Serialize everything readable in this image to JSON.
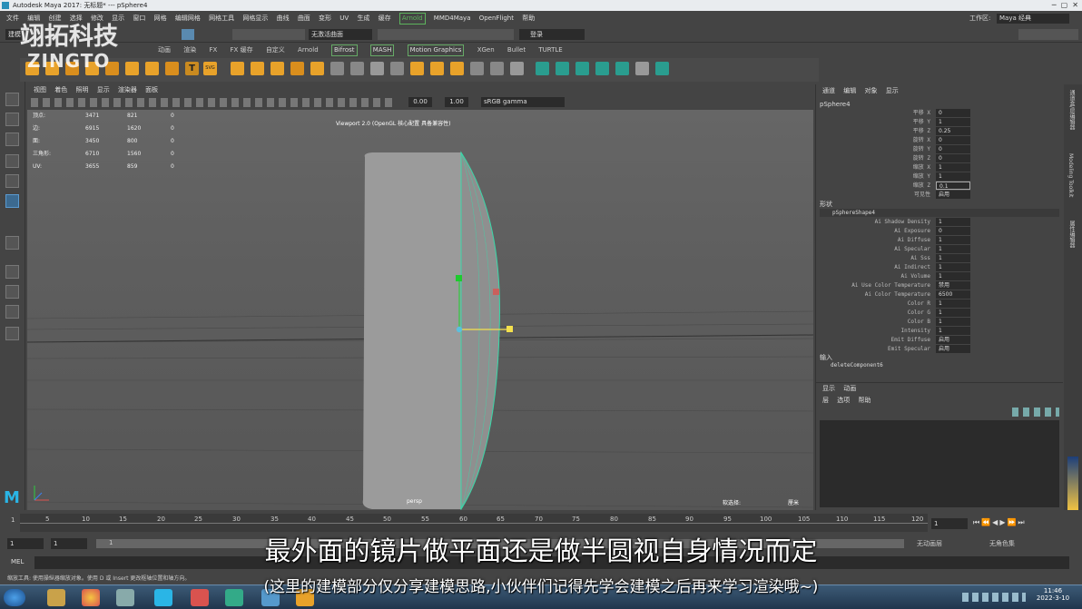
{
  "window": {
    "title": "Autodesk Maya 2017: 无标题*   ---   pSphere4"
  },
  "menu": {
    "items": [
      "文件",
      "编辑",
      "创建",
      "选择",
      "修改",
      "显示",
      "窗口",
      "网格",
      "编辑网格",
      "网格工具",
      "网格显示",
      "曲线",
      "曲面",
      "变形",
      "UV",
      "生成",
      "缓存",
      "Arnold",
      "MMD4Maya",
      "OpenFlight",
      "帮助"
    ],
    "workspace_label": "工作区:",
    "workspace_value": "Maya 经典"
  },
  "statusline": {
    "mode": "建模",
    "no_live": "无激活曲面",
    "login": "登录"
  },
  "shelf_tabs": [
    "动画",
    "渲染",
    "FX",
    "FX 缓存",
    "自定义",
    "Arnold",
    "Bifrost",
    "MASH",
    "Motion Graphics",
    "XGen",
    "Bullet",
    "TURTLE"
  ],
  "viewport": {
    "menu": [
      "视图",
      "着色",
      "照明",
      "显示",
      "渲染器",
      "面板"
    ],
    "exposure": "0.00",
    "gamma": "1.00",
    "colorspace": "sRGB gamma",
    "title": "Viewport 2.0 (OpenGL 核心配置 具备兼容性)",
    "camera": "persp",
    "sel_key": "软选择:",
    "units": "厘米",
    "hud": [
      {
        "label": "顶点:",
        "a": "3471",
        "b": "821",
        "c": "0"
      },
      {
        "label": "边:",
        "a": "6915",
        "b": "1620",
        "c": "0"
      },
      {
        "label": "面:",
        "a": "3450",
        "b": "800",
        "c": "0"
      },
      {
        "label": "三角形:",
        "a": "6710",
        "b": "1560",
        "c": "0"
      },
      {
        "label": "UV:",
        "a": "3655",
        "b": "859",
        "c": "0"
      }
    ]
  },
  "channelbox": {
    "tabs": [
      "通道",
      "编辑",
      "对象",
      "显示"
    ],
    "object": "pSphere4",
    "attrs": [
      {
        "l": "平移 X",
        "v": "0"
      },
      {
        "l": "平移 Y",
        "v": "1"
      },
      {
        "l": "平移 Z",
        "v": "0.25"
      },
      {
        "l": "旋转 X",
        "v": "0"
      },
      {
        "l": "旋转 Y",
        "v": "0"
      },
      {
        "l": "旋转 Z",
        "v": "0"
      },
      {
        "l": "缩放 X",
        "v": "1"
      },
      {
        "l": "缩放 Y",
        "v": "1"
      },
      {
        "l": "缩放 Z",
        "v": "0.1"
      },
      {
        "l": "可见性",
        "v": "启用"
      }
    ],
    "shapes_label": "形状",
    "shape_name": "pSphereShape4",
    "shape_attrs": [
      {
        "l": "Ai Shadow Density",
        "v": "1"
      },
      {
        "l": "Ai Exposure",
        "v": "0"
      },
      {
        "l": "Ai Diffuse",
        "v": "1"
      },
      {
        "l": "Ai Specular",
        "v": "1"
      },
      {
        "l": "Ai Sss",
        "v": "1"
      },
      {
        "l": "Ai Indirect",
        "v": "1"
      },
      {
        "l": "Ai Volume",
        "v": "1"
      },
      {
        "l": "Ai Use Color Temperature",
        "v": "禁用"
      },
      {
        "l": "Ai Color Temperature",
        "v": "6500"
      },
      {
        "l": "Color R",
        "v": "1"
      },
      {
        "l": "Color G",
        "v": "1"
      },
      {
        "l": "Color B",
        "v": "1"
      },
      {
        "l": "Intensity",
        "v": "1"
      },
      {
        "l": "Emit Diffuse",
        "v": "启用"
      },
      {
        "l": "Emit Specular",
        "v": "启用"
      }
    ],
    "inputs_label": "输入",
    "input_name": "deleteComponent6",
    "layer_tabs": [
      "显示",
      "动画"
    ],
    "layer_menu": [
      "层",
      "选项",
      "帮助"
    ]
  },
  "side_tabs": [
    "通道盒/层编辑器",
    "Modeling Toolkit",
    "属性编辑器"
  ],
  "timeline": {
    "ticks": [
      "1",
      "5",
      "10",
      "15",
      "20",
      "25",
      "30",
      "35",
      "40",
      "45",
      "50",
      "55",
      "60",
      "65",
      "70",
      "75",
      "80",
      "85",
      "90",
      "95",
      "100",
      "105",
      "110",
      "115",
      "120"
    ],
    "current": "1"
  },
  "range": {
    "start": "1",
    "start2": "1",
    "end_label": "1",
    "layer": "无动画层",
    "charset": "无角色集"
  },
  "cmd": {
    "label": "MEL"
  },
  "help": "缩放工具: 使用操纵器缩放对象。使用 D 或 Insert 更改枢轴位置和轴方向。",
  "subtitles": {
    "main": "最外面的镜片做平面还是做半圆视自身情况而定",
    "sub": "(这里的建模部分仅分享建模思路,小伙伴们记得先学会建模之后再来学习渲染哦~)"
  },
  "watermark": {
    "cn": "翊拓科技",
    "en": "ZINGTO"
  },
  "taskbar": {
    "time": "11:46",
    "date": "2022-3-10"
  },
  "colors": {
    "wire": "#38d9a9",
    "selection_green": "#5db35d"
  }
}
